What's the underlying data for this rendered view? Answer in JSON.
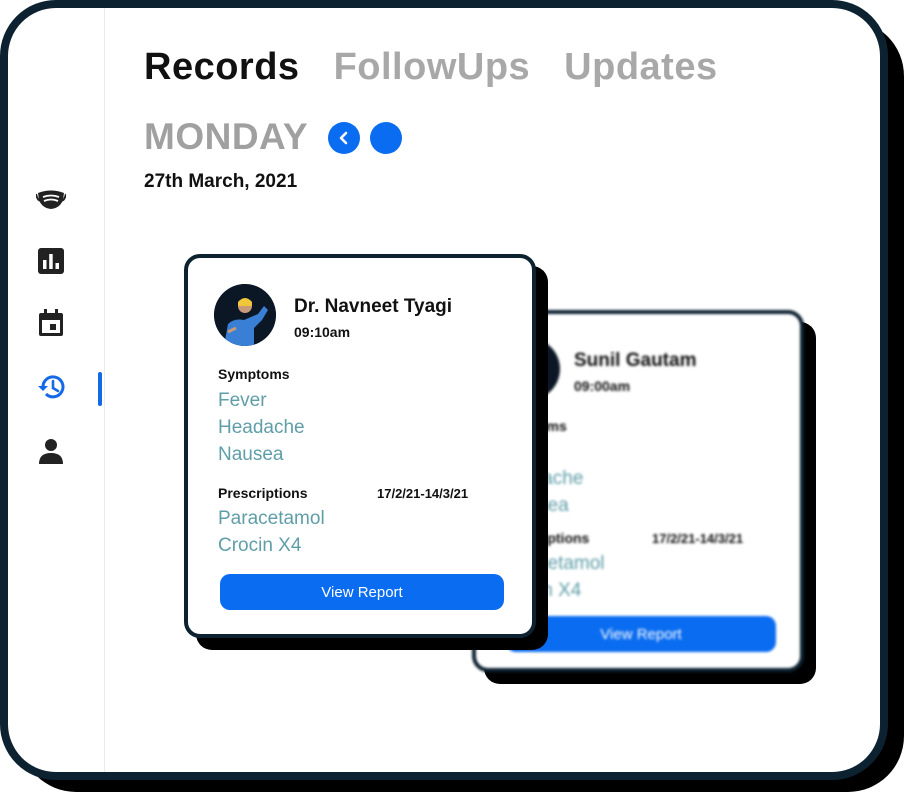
{
  "tabs": [
    {
      "label": "Records",
      "active": true
    },
    {
      "label": "FollowUps",
      "active": false
    },
    {
      "label": "Updates",
      "active": false
    }
  ],
  "day": "MONDAY",
  "date": "27th March, 2021",
  "nav": {
    "prev_icon": "chevron-left-icon",
    "next_icon": "circle-icon"
  },
  "sidebar": {
    "items": [
      {
        "icon": "mask-icon",
        "active": false
      },
      {
        "icon": "bar-chart-icon",
        "active": false
      },
      {
        "icon": "calendar-icon",
        "active": false
      },
      {
        "icon": "history-icon",
        "active": true
      },
      {
        "icon": "person-icon",
        "active": false
      }
    ]
  },
  "colors": {
    "accent": "#0a6cf0",
    "teal_text": "#5f9ea8",
    "frame": "#0d2231",
    "inactive_tab": "#a8a8a8"
  },
  "cards": [
    {
      "doctor": "Dr. Navneet Tyagi",
      "time": "09:10am",
      "symptoms_label": "Symptoms",
      "symptoms": [
        "Fever",
        "Headache",
        "Nausea"
      ],
      "prescriptions_label": "Prescriptions",
      "prescription_range": "17/2/21-14/3/21",
      "prescriptions": [
        "Paracetamol",
        "Crocin X4"
      ],
      "button": "View Report"
    },
    {
      "doctor": "Sunil Gautam",
      "time": "09:00am",
      "symptoms_label": "oms",
      "symptoms": [
        "r",
        "lache",
        "sea"
      ],
      "prescriptions_label": "riptions",
      "prescription_range": "17/2/21-14/3/21",
      "prescriptions": [
        "cetamol",
        "in X4"
      ],
      "button": "View Report"
    }
  ]
}
